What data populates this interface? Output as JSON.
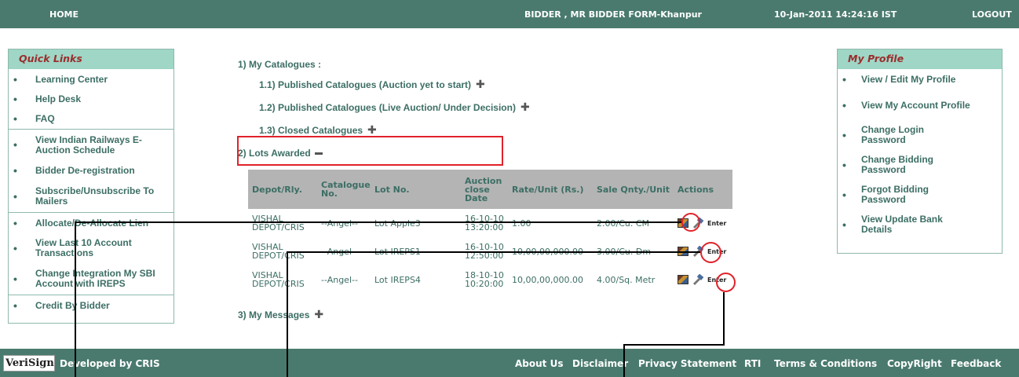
{
  "topbar": {
    "home": "HOME",
    "user": "BIDDER , MR BIDDER FORM-Khanpur",
    "datetime": "10-Jan-2011 14:24:16 IST",
    "logout": "LOGOUT"
  },
  "quick_links": {
    "title": "Quick Links",
    "items": [
      "Learning Center",
      "Help Desk",
      "FAQ",
      "View Indian Railways E-Auction Schedule",
      "Bidder De-registration",
      "Subscribe/Unsubscribe To Mailers",
      "Allocate/De-Allocate Lien",
      "View Last 10 Account Transactions",
      "Change Integration My SBI Account with IREPS",
      "Credit By Bidder"
    ]
  },
  "main": {
    "my_catalogues": "1) My Catalogues :",
    "published_yet": "1.1) Published Catalogues (Auction yet to start)",
    "published_live": "1.2) Published Catalogues (Live Auction/ Under Decision)",
    "closed": "1.3) Closed Catalogues",
    "lots_awarded": "2) Lots Awarded",
    "my_messages": "3) My Messages"
  },
  "lots_table": {
    "headers": [
      "Depot/Rly.",
      "Catalogue No.",
      "Lot No.",
      "Auction close Date",
      "Rate/Unit (Rs.)",
      "Sale Qnty./Unit",
      "Actions"
    ],
    "rows": [
      [
        "VISHAL DEPOT/CRIS",
        "--Angel--",
        "Lot Apple3",
        "16-10-10 13:20:00",
        "1.00",
        "2.00/Cu. CM"
      ],
      [
        "VISHAL DEPOT/CRIS",
        "--Angel--",
        "Lot IREPS1",
        "16-10-10 12:50:00",
        "10,00,00,000.00",
        "3.00/Cu. Dm"
      ],
      [
        "VISHAL DEPOT/CRIS",
        "--Angel--",
        "Lot IREPS4",
        "18-10-10 10:20:00",
        "10,00,00,000.00",
        "4.00/Sq. Metr"
      ]
    ],
    "enter_label": "Enter"
  },
  "my_profile": {
    "title": "My Profile",
    "items": [
      "View / Edit My Profile",
      "View My Account Profile",
      "Change Login Password",
      "Change Bidding Password",
      "Forgot Bidding Password",
      "View Update Bank Details"
    ]
  },
  "footer": {
    "verisign": "VeriSign",
    "developed_by": "Developed by CRIS",
    "links": [
      "About Us",
      "Disclaimer",
      "Privacy Statement",
      "RTI",
      "Terms & Conditions",
      "CopyRight",
      "Feedback"
    ]
  },
  "colors": {
    "header_bg": "#4a7a6e",
    "panel_head_bg": "#9fd6c6",
    "text": "#3c6e64",
    "highlight": "#e0222a"
  }
}
